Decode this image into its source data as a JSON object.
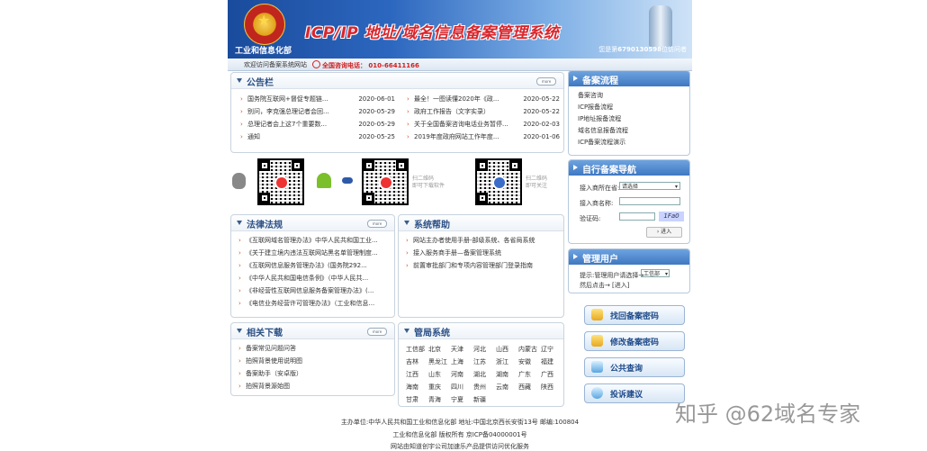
{
  "header": {
    "ministry": "工业和信息化部",
    "title": "ICP/IP 地址/域名信息备案管理系统",
    "visitor_prefix": "您是第",
    "visitor_count": "6790130598",
    "visitor_suffix": "位访问者"
  },
  "welcome": "欢迎访问备案系统网站",
  "phone": "全国咨询电话：  010-66411166",
  "more": "more",
  "notice": {
    "title": "公告栏",
    "left": [
      {
        "t": "国务院互联网+督促专题链...",
        "d": "2020-06-01"
      },
      {
        "t": "别问，李克强总理记者会回...",
        "d": "2020-05-29"
      },
      {
        "t": "总理记者会上这7个重要数...",
        "d": "2020-05-29"
      },
      {
        "t": "通知",
        "d": "2020-05-25"
      }
    ],
    "right": [
      {
        "t": "最全！一图读懂2020年《政...",
        "d": "2020-05-22"
      },
      {
        "t": "政府工作报告（文字实录）",
        "d": "2020-05-22"
      },
      {
        "t": "关于全国备案咨询电话业务暂停...",
        "d": "2020-02-03"
      },
      {
        "t": "2019年度政府网站工作年度...",
        "d": "2020-01-06"
      }
    ]
  },
  "qr": {
    "cap1": "扫二维码\n即可下载软件",
    "cap2": "扫二维码\n即可关注"
  },
  "law": {
    "title": "法律法规",
    "items": [
      "《互联网域名管理办法》中华人民共和国工业...",
      "《关于建立境内违法互联网站黑名单管理制度...",
      "《互联网信息服务管理办法》(国务院292...",
      "《中华人民共和国电信条例》（中华人民共...",
      "《非经营性互联网信息服务备案管理办法》(...",
      "《电信业务经营许可管理办法》（工业和信息..."
    ]
  },
  "help": {
    "title": "系统帮助",
    "items": [
      "网站主办者使用手册-部级系统、各省局系统",
      "接入服务商手册—备案管理系统",
      "前置审批部门和专项内容管理部门登录指南"
    ]
  },
  "download": {
    "title": "相关下载",
    "items": [
      "备案常见问题问答",
      "拍照背景使用说明图",
      "备案助手（安卓版）",
      "拍照背景源始图"
    ]
  },
  "provinces": {
    "title": "管局系统",
    "rows": [
      [
        "工信部",
        "北京",
        "天津",
        "河北",
        "山西",
        "内蒙古",
        "辽宁"
      ],
      [
        "吉林",
        "黑龙江",
        "上海",
        "江苏",
        "浙江",
        "安徽",
        "福建"
      ],
      [
        "江西",
        "山东",
        "河南",
        "湖北",
        "湖南",
        "广东",
        "广西"
      ],
      [
        "海南",
        "重庆",
        "四川",
        "贵州",
        "云南",
        "西藏",
        "陕西"
      ],
      [
        "甘肃",
        "青海",
        "宁夏",
        "新疆"
      ]
    ]
  },
  "flow": {
    "title": "备案流程",
    "items": [
      "备案咨询",
      "ICP报备流程",
      "IP地址报备流程",
      "域名信息报备流程",
      "ICP备案流程演示"
    ]
  },
  "nav": {
    "title": "自行备案导航",
    "province_label": "接入商所在省:",
    "province_value": "请选择",
    "isp_label": "接入商名称:",
    "code_label": "验证码:",
    "captcha": "1Fa0",
    "enter": "进入"
  },
  "admin": {
    "title": "管理用户",
    "hint": "提示:管理用户请选择→",
    "dept": "工信部",
    "then": "然后点击→",
    "enter": "[进入]"
  },
  "buttons": [
    "找回备案密码",
    "修改备案密码",
    "公共查询",
    "投诉建议"
  ],
  "footer": [
    "主办单位:中华人民共和国工业和信息化部 地址:中国北京西长安街13号 邮编:100804",
    "工业和信息化部 版权所有 京ICP备04000001号",
    "网站由知道创宇公司加速乐产品提供访问优化服务"
  ],
  "watermark": "知乎 @62域名专家"
}
